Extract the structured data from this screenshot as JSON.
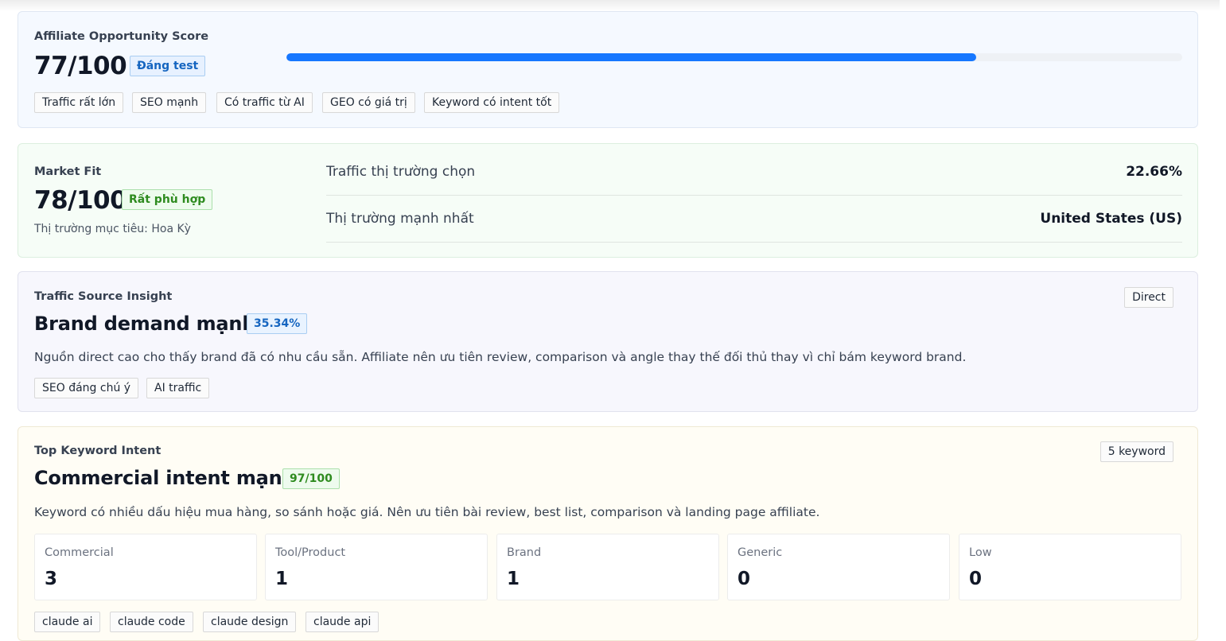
{
  "affiliate": {
    "label": "Affiliate Opportunity Score",
    "score": "77/100",
    "badge": "Đáng test",
    "progress": 0.77,
    "chips": [
      "Traffic rất lớn",
      "SEO mạnh",
      "Có traffic từ AI",
      "GEO có giá trị",
      "Keyword có intent tốt"
    ]
  },
  "market": {
    "label": "Market Fit",
    "score": "78/100",
    "badge": "Rất phù hợp",
    "target": "Thị trường mục tiêu: Hoa Kỳ",
    "rows": [
      {
        "key": "Traffic thị trường chọn",
        "value": "22.66%"
      },
      {
        "key": "Thị trường mạnh nhất",
        "value": "United States (US)"
      }
    ]
  },
  "traffic": {
    "label": "Traffic Source Insight",
    "heading": "Brand demand mạnh",
    "badge": "35.34%",
    "corner": "Direct",
    "description": "Nguồn direct cao cho thấy brand đã có nhu cầu sẵn. Affiliate nên ưu tiên review, comparison và angle thay thế đối thủ thay vì chỉ bám keyword brand.",
    "chips": [
      "SEO đáng chú ý",
      "AI traffic"
    ]
  },
  "keyword": {
    "label": "Top Keyword Intent",
    "heading": "Commercial intent mạnh",
    "badge": "97/100",
    "corner": "5 keyword",
    "description": "Keyword có nhiều dấu hiệu mua hàng, so sánh hoặc giá. Nên ưu tiên bài review, best list, comparison và landing page affiliate.",
    "stats": [
      {
        "label": "Commercial",
        "value": "3"
      },
      {
        "label": "Tool/Product",
        "value": "1"
      },
      {
        "label": "Brand",
        "value": "1"
      },
      {
        "label": "Generic",
        "value": "0"
      },
      {
        "label": "Low",
        "value": "0"
      }
    ],
    "chips": [
      "claude ai",
      "claude code",
      "claude design",
      "claude api"
    ]
  },
  "colors": {
    "accent": "#1677ff",
    "green": "#2e8b1f"
  }
}
